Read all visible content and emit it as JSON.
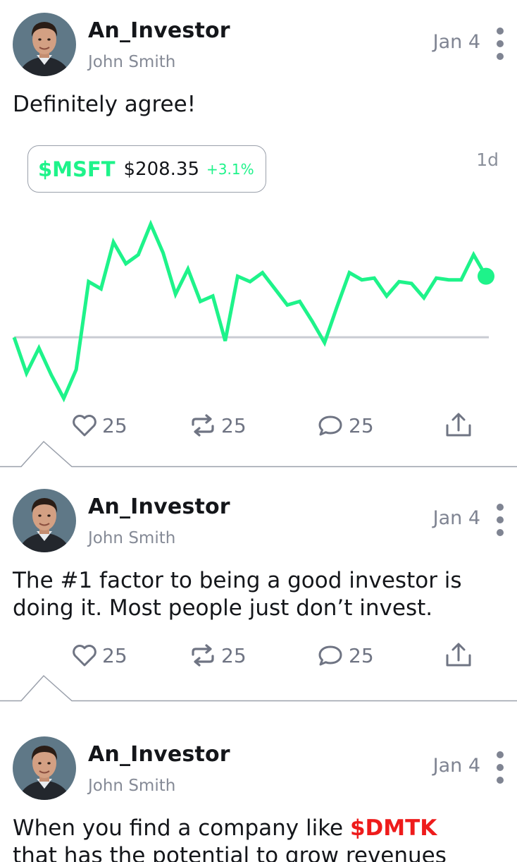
{
  "posts": [
    {
      "username": "An_Investor",
      "fullname": "John Smith",
      "date": "Jan 4",
      "text": "Definitely agree!",
      "ticker": {
        "symbol": "$MSFT",
        "price": "$208.35",
        "change": "+3.1%",
        "period": "1d"
      },
      "actions": {
        "likes": "25",
        "reposts": "25",
        "comments": "25"
      }
    },
    {
      "username": "An_Investor",
      "fullname": "John Smith",
      "date": "Jan 4",
      "text": "The #1 factor to being a good investor is doing it. Most people just don’t invest.",
      "actions": {
        "likes": "25",
        "reposts": "25",
        "comments": "25"
      }
    },
    {
      "username": "An_Investor",
      "fullname": "John Smith",
      "date": "Jan 4",
      "text_before": "When you find a company like ",
      "text_ticker": "$DMTK",
      "text_after": " that has the potential to grow revenues"
    }
  ],
  "icons": {
    "avatar": "user-avatar-photo",
    "more": "vertical-ellipsis-icon",
    "like": "heart-icon",
    "repost": "repost-icon",
    "comment": "comment-bubble-icon",
    "share": "share-icon"
  },
  "colors": {
    "positive": "#1ef38a",
    "ticker_mention": "#ee1b1b",
    "baseline": "#c9ccd3",
    "muted_text": "#7f8492"
  },
  "chart_data": {
    "type": "line",
    "title": "",
    "xlabel": "",
    "ylabel": "",
    "series": [
      {
        "values": [
          100,
          98,
          99.4,
          97.9,
          96.6,
          98.2,
          103.1,
          102.7,
          105.3,
          104.1,
          104.6,
          106.3,
          104.7,
          102.4,
          103.8,
          102.0,
          102.3,
          99.8,
          103.4,
          103.1,
          103.6,
          102.7,
          101.8,
          102.0,
          100.9,
          99.7,
          101.7,
          103.6,
          103.2,
          103.3,
          102.3,
          103.1,
          103.0,
          102.2,
          103.3,
          103.2,
          103.2,
          104.6,
          103.4
        ]
      }
    ],
    "baseline": 100,
    "ylim": [
      96,
      107
    ],
    "grid": false,
    "legend": "none"
  }
}
